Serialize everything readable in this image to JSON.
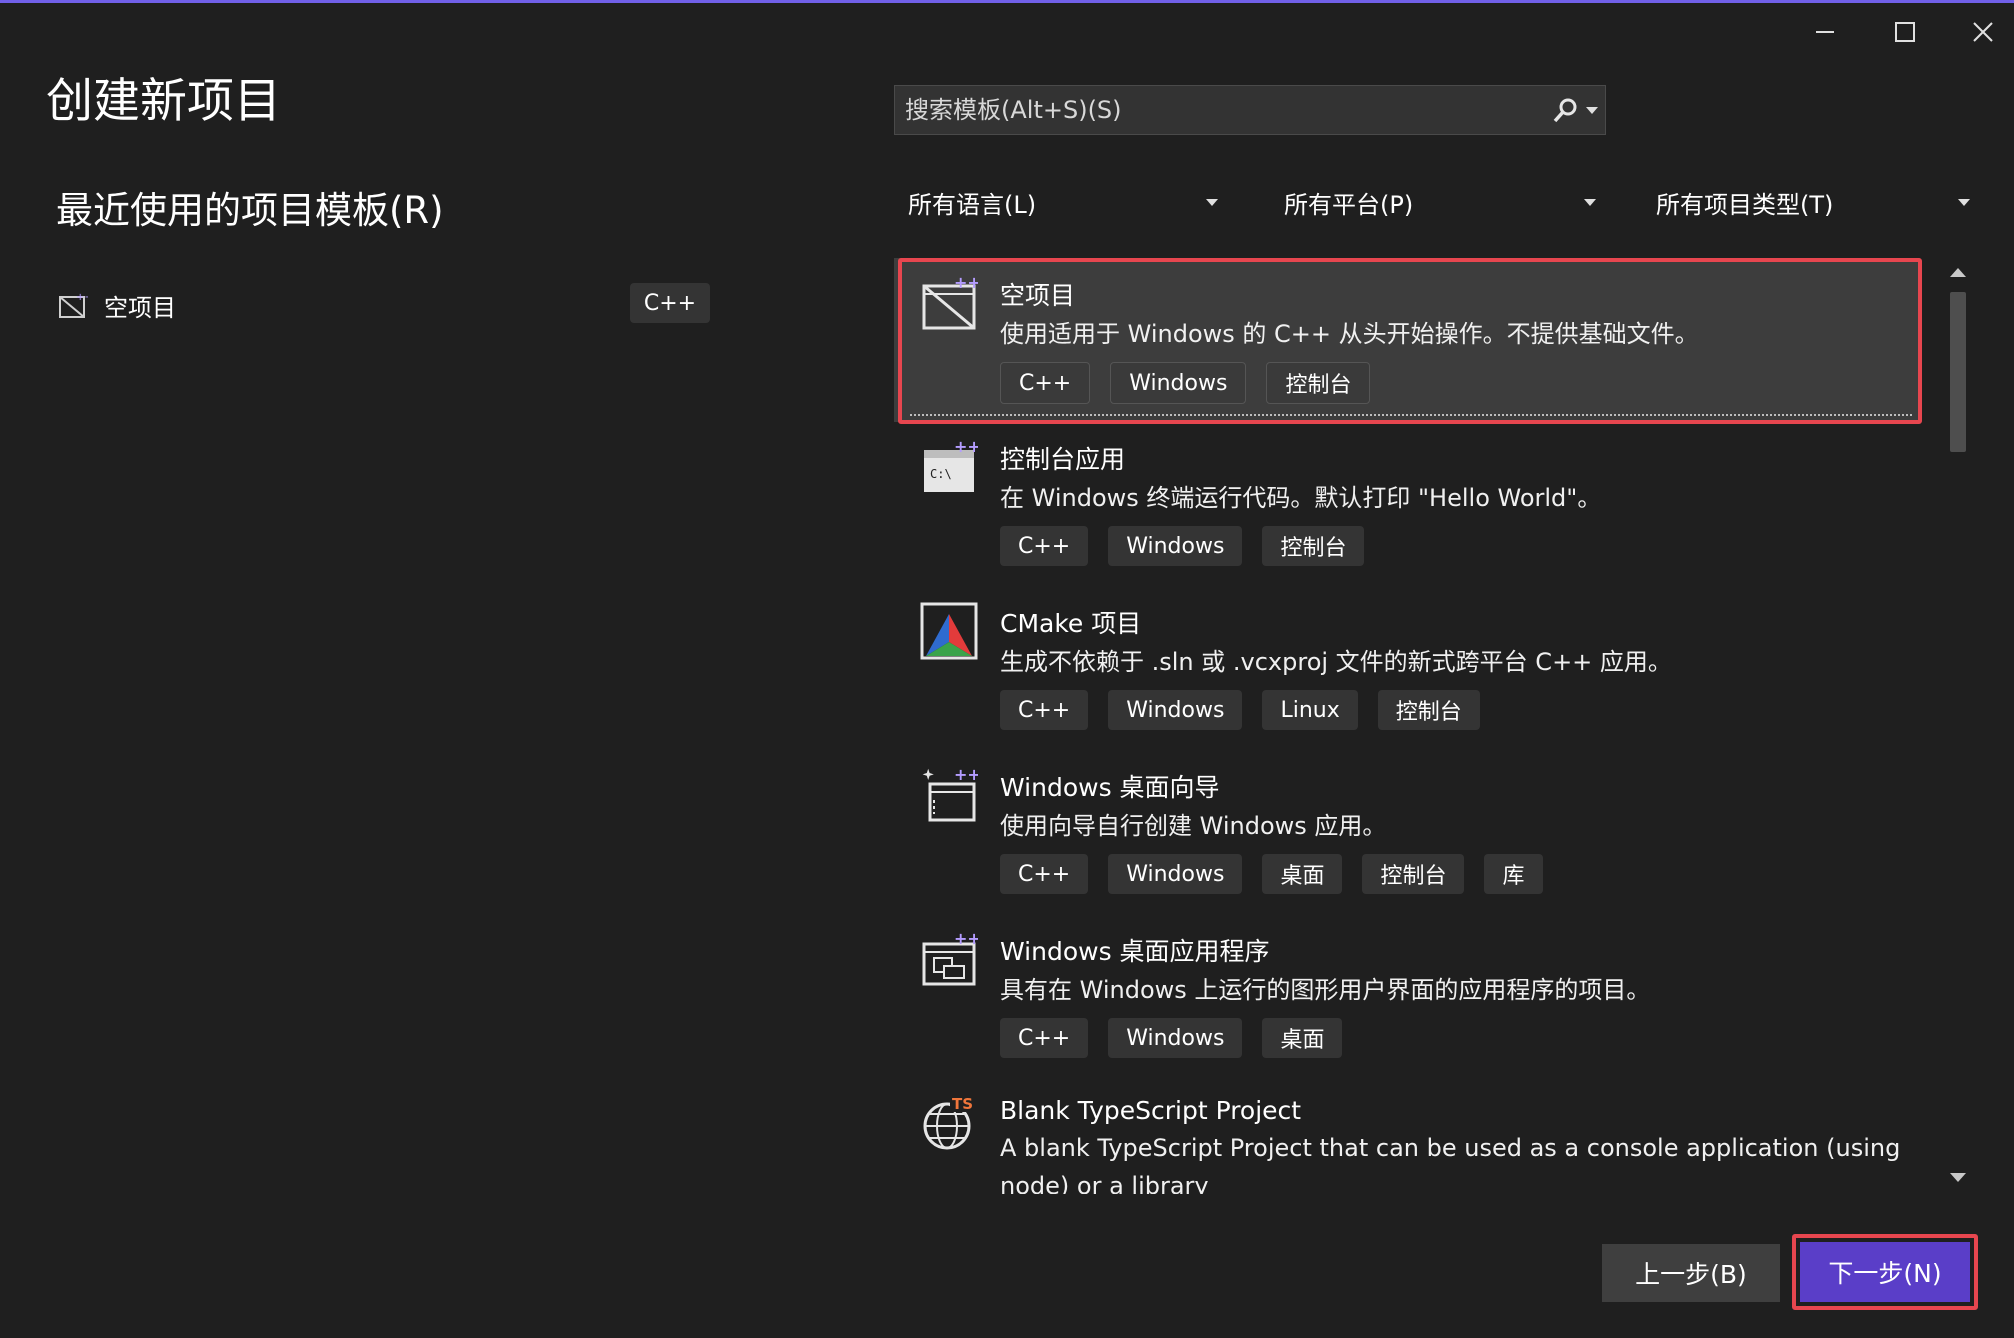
{
  "window": {
    "title": "创建新项目"
  },
  "recent": {
    "heading": "最近使用的项目模板(R)",
    "items": [
      {
        "label": "空项目",
        "tag": "C++"
      }
    ]
  },
  "search": {
    "placeholder": "搜索模板(Alt+S)(S)"
  },
  "filters": {
    "language": "所有语言(L)",
    "platform": "所有平台(P)",
    "project_type": "所有项目类型(T)"
  },
  "templates": [
    {
      "name": "空项目",
      "description": "使用适用于 Windows 的 C++ 从头开始操作。不提供基础文件。",
      "tags": [
        "C++",
        "Windows",
        "控制台"
      ],
      "selected": true,
      "icon": "empty-project-icon"
    },
    {
      "name": "控制台应用",
      "description": "在 Windows 终端运行代码。默认打印 \"Hello World\"。",
      "tags": [
        "C++",
        "Windows",
        "控制台"
      ],
      "selected": false,
      "icon": "console-app-icon"
    },
    {
      "name": "CMake 项目",
      "description": "生成不依赖于 .sln 或 .vcxproj 文件的新式跨平台 C++ 应用。",
      "tags": [
        "C++",
        "Windows",
        "Linux",
        "控制台"
      ],
      "selected": false,
      "icon": "cmake-icon"
    },
    {
      "name": "Windows 桌面向导",
      "description": "使用向导自行创建 Windows 应用。",
      "tags": [
        "C++",
        "Windows",
        "桌面",
        "控制台",
        "库"
      ],
      "selected": false,
      "icon": "desktop-wizard-icon"
    },
    {
      "name": "Windows 桌面应用程序",
      "description": "具有在 Windows 上运行的图形用户界面的应用程序的项目。",
      "tags": [
        "C++",
        "Windows",
        "桌面"
      ],
      "selected": false,
      "icon": "desktop-app-icon"
    },
    {
      "name": "Blank TypeScript Project",
      "description": "A blank TypeScript Project that can be used as a console application (using",
      "description2": "node) or a library",
      "tags": [],
      "selected": false,
      "icon": "typescript-globe-icon"
    }
  ],
  "buttons": {
    "back": "上一步(B)",
    "next": "下一步(N)"
  },
  "colors": {
    "accent": "#5a3ec8",
    "highlight_border": "#e7464f",
    "top_line": "#7160e8"
  }
}
